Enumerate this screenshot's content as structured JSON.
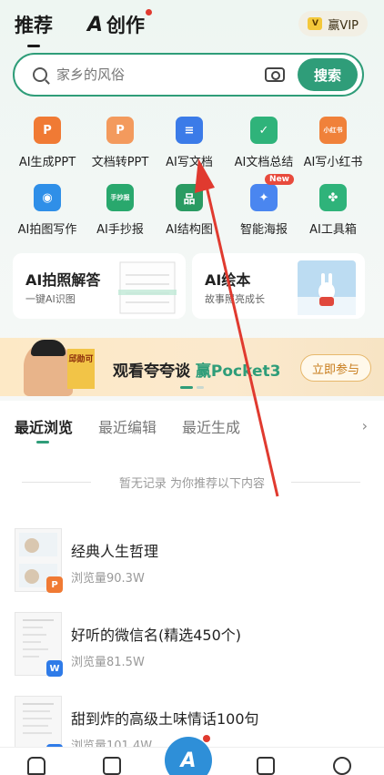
{
  "header": {
    "tab_recommend": "推荐",
    "tab_create": "创作",
    "logo": "A",
    "vip_icon": "V",
    "vip_label": "赢VIP"
  },
  "search": {
    "placeholder": "家乡的风俗",
    "button_label": "搜索"
  },
  "tools": [
    {
      "label": "AI生成PPT",
      "icon": "ppt-icon",
      "glyph": "P",
      "color": "#f07a34"
    },
    {
      "label": "文档转PPT",
      "icon": "doc-to-ppt-icon",
      "glyph": "P",
      "color": "#f39a5d"
    },
    {
      "label": "AI写文档",
      "icon": "write-doc-icon",
      "glyph": "≡",
      "color": "#3b7be8"
    },
    {
      "label": "AI文档总结",
      "icon": "summary-icon",
      "glyph": "✓",
      "color": "#2fb37a"
    },
    {
      "label": "AI写小红书",
      "icon": "xiaohongshu-icon",
      "glyph": "小红书",
      "color": "#f0813a"
    },
    {
      "label": "AI拍图写作",
      "icon": "camera-write-icon",
      "glyph": "◉",
      "color": "#2f8fe8"
    },
    {
      "label": "AI手抄报",
      "icon": "handwritten-newspaper-icon",
      "glyph": "手抄报",
      "color": "#29a86d"
    },
    {
      "label": "AI结构图",
      "icon": "structure-diagram-icon",
      "glyph": "品",
      "color": "#2a9b62"
    },
    {
      "label": "智能海报",
      "icon": "poster-icon",
      "glyph": "✦",
      "color": "#4a86f0",
      "badge": "New"
    },
    {
      "label": "AI工具箱",
      "icon": "toolbox-icon",
      "glyph": "✤",
      "color": "#2fb37a"
    }
  ],
  "cards": [
    {
      "title": "AI拍照解答",
      "subtitle": "一键AI识图"
    },
    {
      "title": "AI绘本",
      "subtitle": "故事照亮成长"
    }
  ],
  "banner": {
    "tag": "邱勋可",
    "text_prefix": "观看夸夸谈 ",
    "text_highlight": "赢Pocket3",
    "button_label": "立即参与"
  },
  "recent": {
    "tabs": [
      "最近浏览",
      "最近编辑",
      "最近生成"
    ],
    "empty_text": "暂无记录 为你推荐以下内容"
  },
  "documents": [
    {
      "title": "经典人生哲理",
      "views": "浏览量90.3W",
      "badge": "P",
      "badge_color": "#f07a34"
    },
    {
      "title": "好听的微信名(精选450个)",
      "views": "浏览量81.5W",
      "badge": "W",
      "badge_color": "#2f7be8"
    },
    {
      "title": "甜到炸的高级土味情话100句",
      "views": "浏览量101.4W",
      "badge": "W",
      "badge_color": "#2f7be8"
    }
  ],
  "bottom_nav": {
    "center_logo": "A"
  },
  "colors": {
    "accent": "#2f9d79",
    "annotation_arrow": "#e03a2f"
  }
}
